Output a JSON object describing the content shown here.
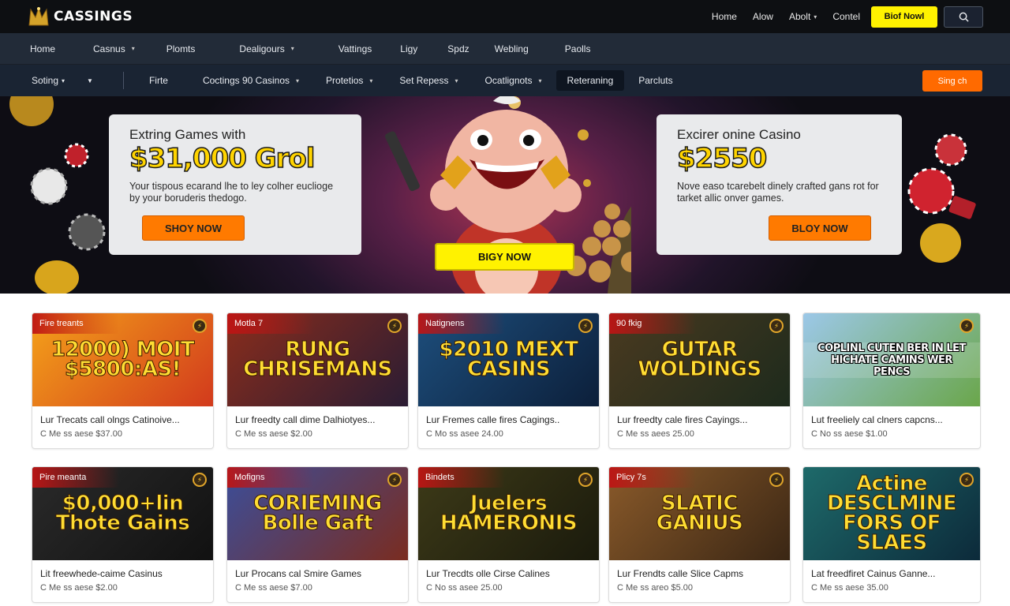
{
  "brand": {
    "name": "CASSINGS"
  },
  "top_links": [
    {
      "label": "Home",
      "has_menu": false
    },
    {
      "label": "Alow",
      "has_menu": false
    },
    {
      "label": "Abolt",
      "has_menu": true
    },
    {
      "label": "Contel",
      "has_menu": false
    }
  ],
  "top_cta": "Biof Nowl",
  "nav_primary": [
    {
      "label": "Home",
      "has_menu": false
    },
    {
      "label": "Casnus",
      "has_menu": true
    },
    {
      "label": "Plomts",
      "has_menu": false
    },
    {
      "label": "Dealigours",
      "has_menu": true
    },
    {
      "label": "Vattings",
      "has_menu": false
    },
    {
      "label": "Ligy",
      "has_menu": false
    },
    {
      "label": "Spdz",
      "has_menu": false
    },
    {
      "label": "Webling",
      "has_menu": false
    },
    {
      "label": "Paolls",
      "has_menu": false
    }
  ],
  "nav_secondary": {
    "sort_label": "Soting",
    "items": [
      {
        "label": "Firte",
        "has_menu": false,
        "active": false
      },
      {
        "label": "Coctings 90 Casinos",
        "has_menu": true,
        "active": false
      },
      {
        "label": "Protetios",
        "has_menu": true,
        "active": false
      },
      {
        "label": "Set Repess",
        "has_menu": true,
        "active": false
      },
      {
        "label": "Ocatlignots",
        "has_menu": true,
        "active": false
      },
      {
        "label": "Reteraning",
        "has_menu": false,
        "active": true
      },
      {
        "label": "Parcluts",
        "has_menu": false,
        "active": false
      }
    ],
    "cta": "Sing ch"
  },
  "hero": {
    "left": {
      "title": "Extring Games with",
      "amount": "$31,000 Grol",
      "desc": "Your tispous ecarand lhe to ley colher euclioge by your boruderis thedogo.",
      "button": "SHOY NOW"
    },
    "center_button": "BIGY NOW",
    "right": {
      "title": "Excirer onine Casino",
      "amount": "$2550",
      "desc": "Nove easo tcarebelt dinely crafted gans rot for tarket allic onver games.",
      "button": "BLOY NOW"
    }
  },
  "games": [
    {
      "tag": "Fire treants",
      "art": "12000) MOIT $5800:AS!",
      "title": "Lur Trecats call olngs Catinoive...",
      "meta": "C Me ss aese $37.00",
      "bg": "#f4a21a",
      "bg2": "#d23a1c"
    },
    {
      "tag": "Motla 7",
      "art": "RUNG CHRISEMANS",
      "title": "Lur freedty call dime Dalhiotyes...",
      "meta": "C Me ss aese $2.00",
      "bg": "#8a2d1c",
      "bg2": "#2a1c33"
    },
    {
      "tag": "Natignens",
      "art": "$2010 MEXT CASINS",
      "title": "Lur Fremes calle fires Cagings..",
      "meta": "C Mo ss asee 24.00",
      "bg": "#1d4e7c",
      "bg2": "#0c1f3a"
    },
    {
      "tag": "90 fkig",
      "art": "GUTAR WOLDINGS",
      "title": "Lur freedty cale fires Cayings...",
      "meta": "C Me ss aees 25.00",
      "bg": "#4a3a20",
      "bg2": "#1d2a1c"
    },
    {
      "tag": "",
      "art": "COPLINL CUTEN BER IN LET HICHATE CAMINS WER PENCS",
      "title": "Lut freeliely cal clners capcns...",
      "meta": "C No ss aese $1.00",
      "bg": "#9cc8e8",
      "bg2": "#6aa64a"
    },
    {
      "tag": "Pire meanta",
      "art": "$0,000+lin Thote Gains",
      "title": "Lit freewhede-caime Casinus",
      "meta": "C Me ss aese $2.00",
      "bg": "#2a2a2a",
      "bg2": "#111111"
    },
    {
      "tag": "Mofigns",
      "art": "CORIEMING Bolle Gaft",
      "title": "Lur Procans cal Smire Games",
      "meta": "C Me ss aese $7.00",
      "bg": "#3b4e9a",
      "bg2": "#7a2c20"
    },
    {
      "tag": "Bindets",
      "art": "Juelers HAMERONIS",
      "title": "Lur Trecdts olle Cirse Calines",
      "meta": "C No ss asee 25.00",
      "bg": "#3d3a18",
      "bg2": "#1a1a0c"
    },
    {
      "tag": "Plicy 7s",
      "art": "SLATIC GANIUS",
      "title": "Lur Frendts calle Slice Capms",
      "meta": "C Me ss areo $5.00",
      "bg": "#8a5a2a",
      "bg2": "#3a2614"
    },
    {
      "tag": "",
      "art": "Actine DESCLMINE FORS OF SLAES",
      "title": "Lat freedfiret Cainus Ganne...",
      "meta": "C Me ss aese 35.00",
      "bg": "#1e6a6a",
      "bg2": "#0c2a3a"
    }
  ],
  "colors": {
    "accent_yellow": "#fff200",
    "accent_orange": "#ff6a00",
    "nav_dark": "#222b38"
  }
}
